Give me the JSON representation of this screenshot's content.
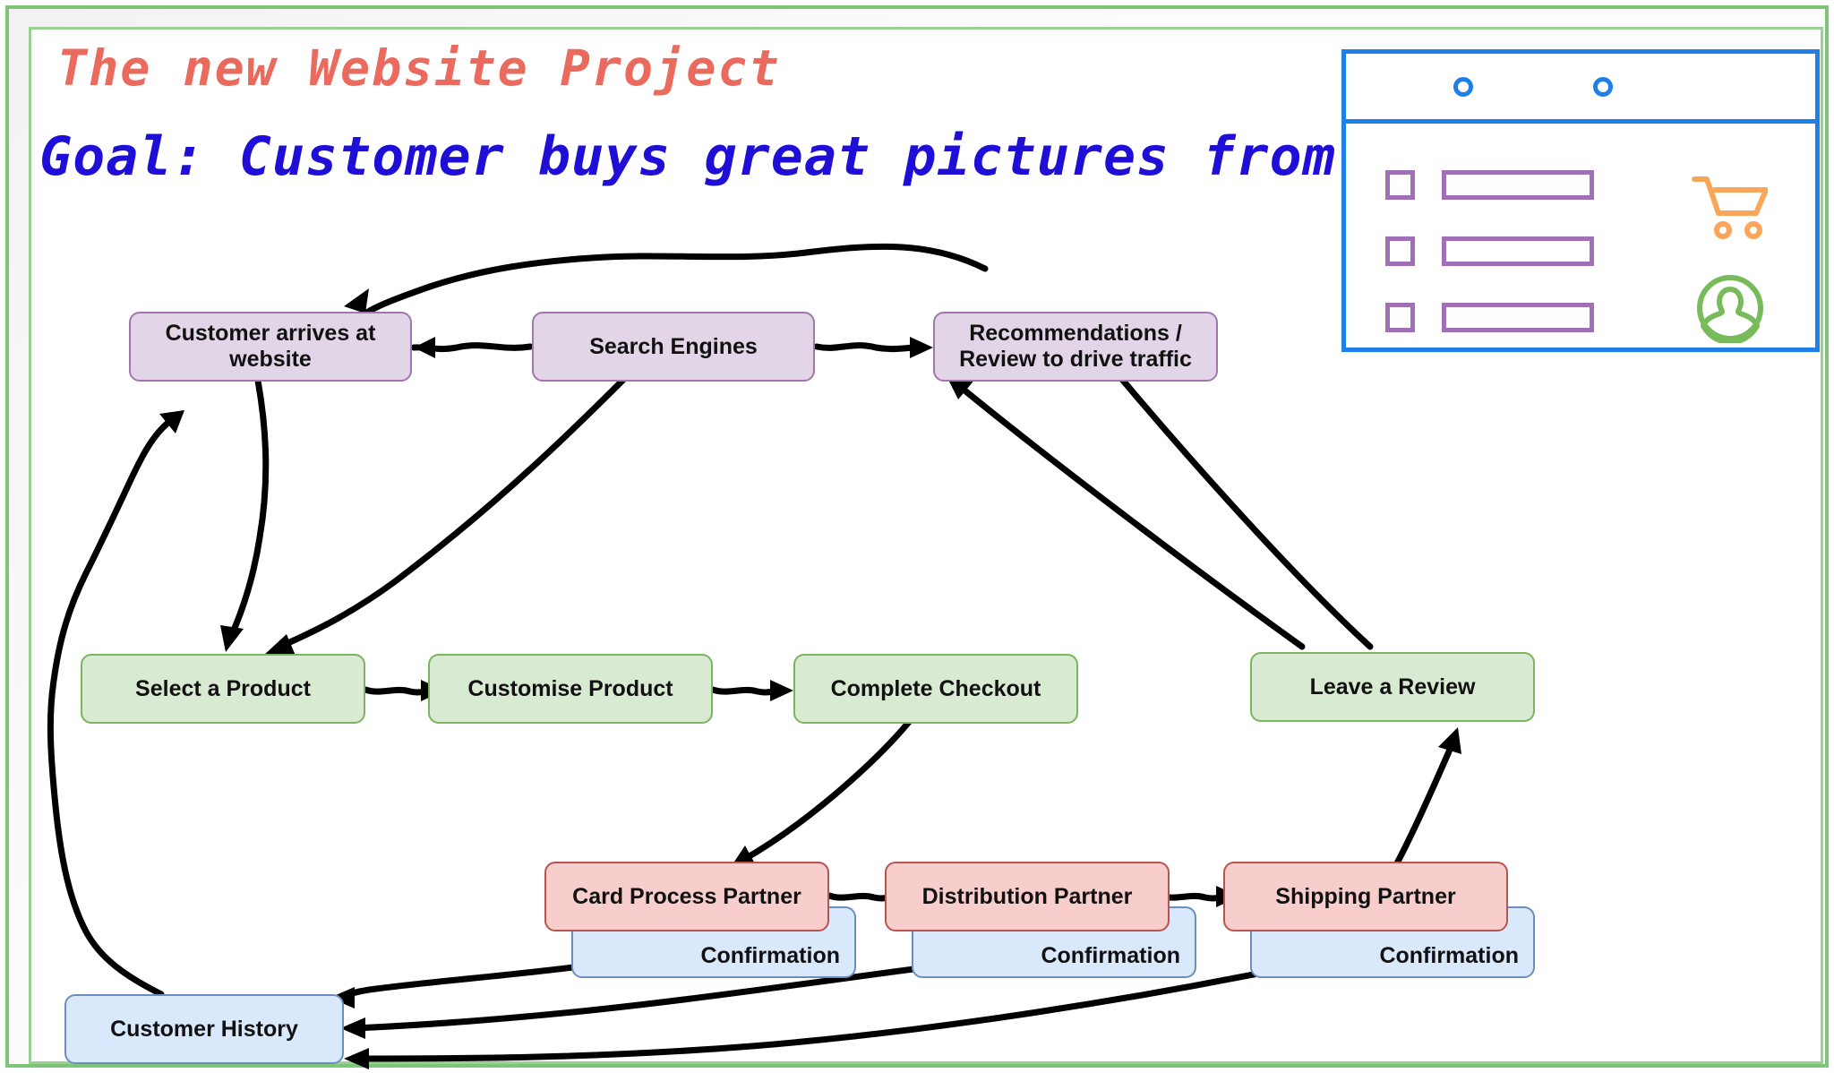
{
  "board": {
    "title": "The new Website Project",
    "goal": "Goal: Customer buys great pictures from us",
    "title_color": "#ea6a5e",
    "goal_color": "#1f0fd6",
    "frame_color": "#7cc576"
  },
  "nodes": {
    "customer_arrives": "Customer arrives at website",
    "search_engines": "Search Engines",
    "recommendations": "Recommendations / Review to drive traffic",
    "select_product": "Select a Product",
    "customise_product": "Customise Product",
    "complete_checkout": "Complete Checkout",
    "leave_review": "Leave a Review",
    "card_process_partner": "Card Process Partner",
    "distribution_partner": "Distribution Partner",
    "shipping_partner": "Shipping Partner",
    "confirmation_1": "Confirmation",
    "confirmation_2": "Confirmation",
    "confirmation_3": "Confirmation",
    "customer_history": "Customer History"
  },
  "palette": {
    "purple_fill": "#e3d5e8",
    "purple_stroke": "#9f77ab",
    "green_fill": "#d9ead3",
    "green_stroke": "#7cb35f",
    "red_fill": "#f8cecc",
    "red_stroke": "#b85450",
    "blue_fill": "#dae8fc",
    "blue_stroke": "#6c8ebf",
    "arrow": "#000000"
  },
  "browser_mockup": {
    "border_color": "#1f7fe8",
    "dot_color": "#1f7fe8",
    "list_color": "#a06fb5",
    "cart_color": "#f9a65a",
    "user_color": "#77bb5a",
    "list_rows": 3,
    "dots": 2,
    "icons": [
      "shopping-cart-icon",
      "user-account-icon"
    ]
  },
  "edges": [
    {
      "from": "search_engines",
      "to": "customer_arrives",
      "style": "wavy"
    },
    {
      "from": "search_engines",
      "to": "recommendations",
      "style": "wavy"
    },
    {
      "from": "recommendations",
      "to": "customer_arrives",
      "style": "wavy-arc"
    },
    {
      "from": "customer_arrives",
      "to": "select_product",
      "style": "straight"
    },
    {
      "from": "search_engines",
      "to": "select_product",
      "style": "straight"
    },
    {
      "from": "leave_review",
      "to": "search_engines",
      "style": "straight"
    },
    {
      "from": "leave_review",
      "to": "recommendations",
      "style": "straight"
    },
    {
      "from": "select_product",
      "to": "customise_product",
      "style": "wavy"
    },
    {
      "from": "customise_product",
      "to": "complete_checkout",
      "style": "wavy"
    },
    {
      "from": "complete_checkout",
      "to": "card_process_partner",
      "style": "straight"
    },
    {
      "from": "card_process_partner",
      "to": "distribution_partner",
      "style": "wavy"
    },
    {
      "from": "distribution_partner",
      "to": "shipping_partner",
      "style": "wavy"
    },
    {
      "from": "shipping_partner",
      "to": "leave_review",
      "style": "straight"
    },
    {
      "from": "confirmation_1",
      "to": "customer_history",
      "style": "wavy"
    },
    {
      "from": "confirmation_2",
      "to": "customer_history",
      "style": "wavy"
    },
    {
      "from": "confirmation_3",
      "to": "customer_history",
      "style": "wavy"
    },
    {
      "from": "customer_history",
      "to": "customer_arrives",
      "style": "wavy-long"
    }
  ]
}
